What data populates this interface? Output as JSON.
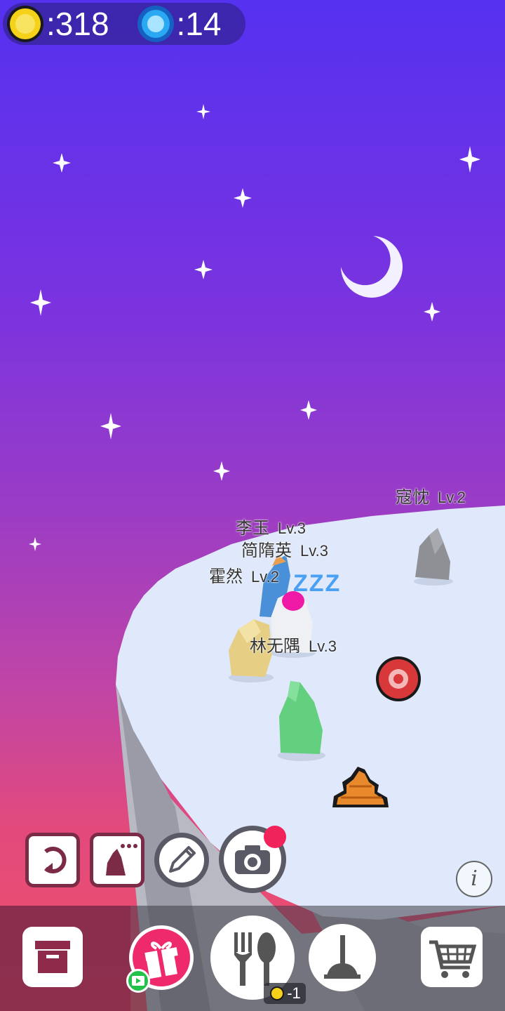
{
  "hud": {
    "coins_text": ":318",
    "gems_text": ":14"
  },
  "characters": [
    {
      "name": "寇忱",
      "level": "Lv.2"
    },
    {
      "name": "李玉",
      "level": "Lv.3"
    },
    {
      "name": "简隋英",
      "level": "Lv.3"
    },
    {
      "name": "霍然",
      "level": "Lv.2"
    },
    {
      "name": "林无隅",
      "level": "Lv.3"
    }
  ],
  "sleep_text": "ZZZ",
  "toolbar": {
    "info_label": "i"
  },
  "nav": {
    "feed_cost_text": "-1"
  },
  "colors": {
    "coin": "#f5d21a",
    "gem": "#2aa9f2",
    "notification_badge": "#f0235a",
    "gift_button": "#ef2a6c",
    "ad_badge": "#22c24a"
  },
  "icons": [
    "coin-icon",
    "gem-icon",
    "rotate-icon",
    "pet-menu-icon",
    "pencil-icon",
    "camera-icon",
    "info-icon",
    "storage-box-icon",
    "gift-icon",
    "video-ad-icon",
    "fork-spoon-icon",
    "plunger-icon",
    "cart-icon"
  ]
}
